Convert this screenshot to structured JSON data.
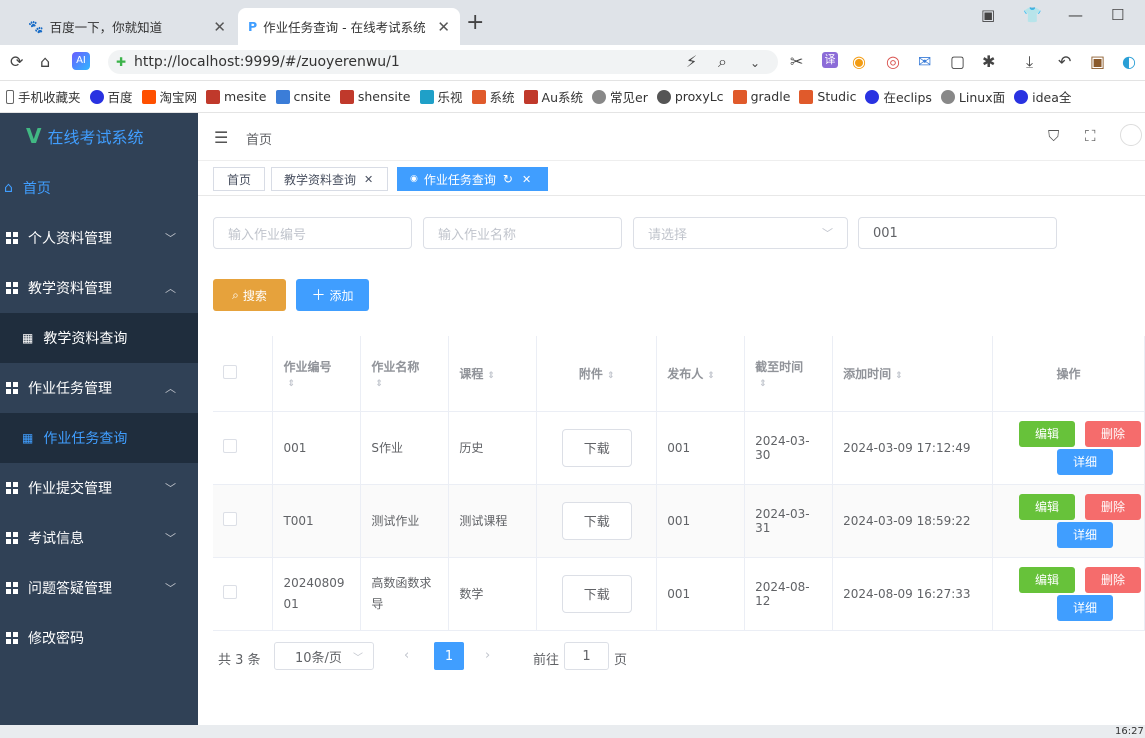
{
  "browser": {
    "tabs": [
      {
        "label": "百度一下，你就知道"
      },
      {
        "label": "作业任务查询 - 在线考试系统"
      }
    ],
    "url": "http://localhost:9999/#/zuoyerenwu/1",
    "bookmarks": [
      "手机收藏夹",
      "百度",
      "淘宝网",
      "mesite",
      "cnsite",
      "shensite",
      "乐视",
      "系统",
      "Au系统",
      "常见er",
      "proxyLc",
      "gradle",
      "Studic",
      "在eclips",
      "Linux面",
      "idea全"
    ]
  },
  "sidebar": {
    "app_title": "在线考试系统",
    "items": [
      {
        "label": "首页"
      },
      {
        "label": "个人资料管理"
      },
      {
        "label": "教学资料管理"
      },
      {
        "label": "教学资料查询"
      },
      {
        "label": "作业任务管理"
      },
      {
        "label": "作业任务查询"
      },
      {
        "label": "作业提交管理"
      },
      {
        "label": "考试信息"
      },
      {
        "label": "问题答疑管理"
      },
      {
        "label": "修改密码"
      }
    ]
  },
  "breadcrumb": "首页",
  "tags": [
    {
      "label": "首页"
    },
    {
      "label": "教学资料查询"
    },
    {
      "label": "作业任务查询"
    }
  ],
  "search": {
    "number_placeholder": "输入作业编号",
    "name_placeholder": "输入作业名称",
    "select_placeholder": "请选择",
    "publisher_value": "001",
    "search_label": "搜索",
    "add_label": "添加"
  },
  "table": {
    "headers": [
      "作业编号",
      "作业名称",
      "课程",
      "附件",
      "发布人",
      "截至时间",
      "添加时间",
      "操作"
    ],
    "rows": [
      {
        "code": "001",
        "name": "S作业",
        "course": "历史",
        "file": "下载",
        "publisher": "001",
        "deadline": "2024-03-30",
        "added": "2024-03-09 17:12:49"
      },
      {
        "code": "T001",
        "name": "测试作业",
        "course": "测试课程",
        "file": "下载",
        "publisher": "001",
        "deadline": "2024-03-31",
        "added": "2024-03-09 18:59:22"
      },
      {
        "code": "2024080901",
        "name": "高数函数求导",
        "course": "数学",
        "file": "下载",
        "publisher": "001",
        "deadline": "2024-08-12",
        "added": "2024-08-09 16:27:33"
      }
    ],
    "actions": {
      "edit": "编辑",
      "delete": "删除",
      "detail": "详细"
    }
  },
  "pagination": {
    "total": "共 3 条",
    "page_size": "10条/页",
    "current": "1",
    "goto_prefix": "前往",
    "goto_value": "1",
    "goto_suffix": "页"
  },
  "taskbar": {
    "time": "16:27"
  }
}
